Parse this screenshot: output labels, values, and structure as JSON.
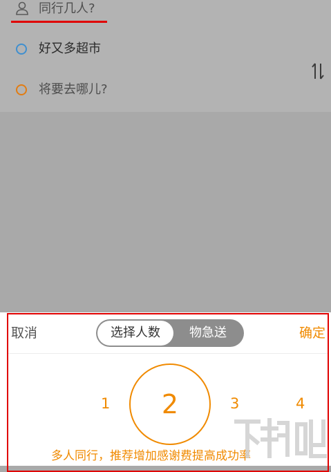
{
  "trip": {
    "passenger_placeholder": "同行几人?",
    "start_location": "好又多超市",
    "destination_placeholder": "将要去哪儿?"
  },
  "picker": {
    "cancel_label": "取消",
    "confirm_label": "确定",
    "tabs": [
      "选择人数",
      "物急送"
    ],
    "selected_tab": "选择人数",
    "options": [
      "1",
      "2",
      "3",
      "4"
    ],
    "selected_value": "2",
    "hint": "多人同行，推荐增加感谢费提高成功率"
  },
  "colors": {
    "accent": "#f08a00",
    "annotation_red": "#e00000",
    "start_dot": "#3f8fcf",
    "dest_dot": "#e27c12",
    "overlay": "#a9a9a9"
  },
  "icons": [
    "person-icon",
    "swap-icon",
    "watermark-logo"
  ]
}
